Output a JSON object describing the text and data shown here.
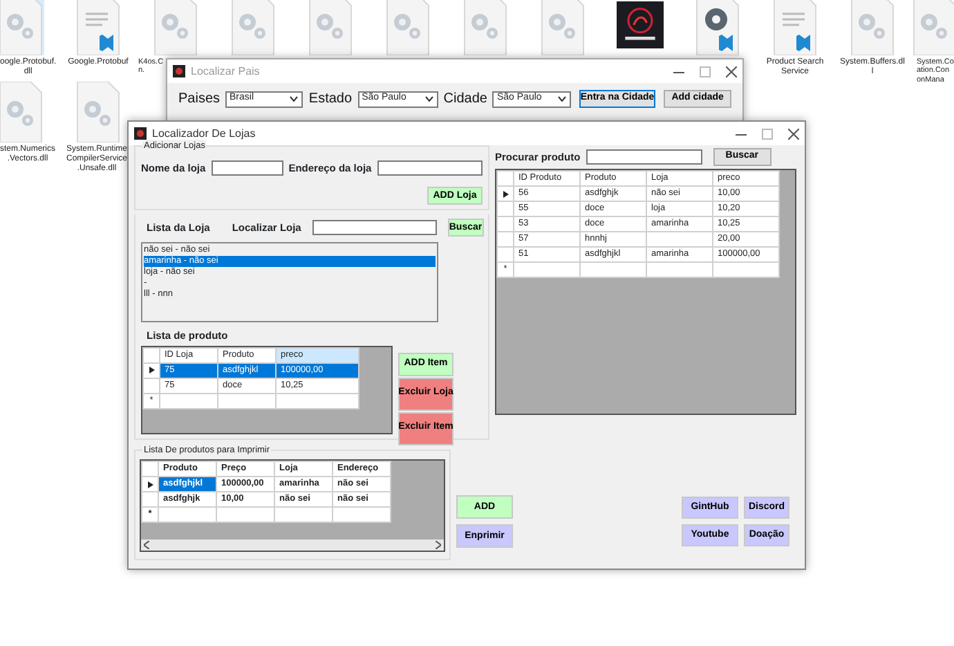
{
  "desktop": {
    "icons": [
      {
        "kind": "gear",
        "selected": true,
        "label": [
          "oogle.Protobuf.",
          "dll"
        ]
      },
      {
        "kind": "code_doc",
        "selected": false,
        "label": [
          "Google.Protobuf"
        ]
      },
      {
        "kind": "gear",
        "selected": false,
        "label": [
          "K4os.C",
          "n."
        ]
      },
      {
        "kind": "gear",
        "selected": false
      },
      {
        "kind": "gear",
        "selected": false
      },
      {
        "kind": "gear",
        "selected": false
      },
      {
        "kind": "gear",
        "selected": false
      },
      {
        "kind": "gear",
        "selected": false
      },
      {
        "kind": "logo",
        "selected": false
      },
      {
        "kind": "code_gear",
        "selected": false
      },
      {
        "kind": "code_doc",
        "selected": false,
        "label": [
          "Product Search",
          "Service"
        ]
      },
      {
        "kind": "gear",
        "selected": false,
        "label": [
          "System.Buffers.dl",
          "l"
        ]
      },
      {
        "kind": "gear",
        "selected": false,
        "label": [
          "System.Co",
          "ation.Con",
          "onMana"
        ]
      }
    ],
    "icons_row_2": [
      {
        "kind": "gear",
        "selected": false,
        "label": [
          "stem.Numerics",
          ".Vectors.dll"
        ]
      },
      {
        "kind": "gear",
        "selected": false,
        "label": [
          "System.Runtime",
          "CompilerService",
          ".Unsafe.dll"
        ]
      }
    ]
  },
  "country_window": {
    "title": "Localizar Pais",
    "fields": [
      {
        "label": "Paises",
        "value": "Brasil"
      },
      {
        "label": "Estado",
        "value": "São Paulo"
      },
      {
        "label": "Cidade",
        "value": "São Paulo"
      }
    ],
    "buttons": [
      {
        "label": "Entra na Cidade",
        "focused": true
      },
      {
        "label": "Add cidade",
        "focused": false
      }
    ]
  },
  "store_window": {
    "title": "Localizador De Lojas",
    "add_store": {
      "legend": "Adicionar Lojas",
      "fields": [
        {
          "label": "Nome da loja"
        },
        {
          "label": "Endereço da loja"
        }
      ],
      "button": "ADD Loja"
    },
    "store_list": {
      "heading": "Lista da Loja",
      "search_label": "Localizar Loja",
      "search_button": "Buscar",
      "items": [
        {
          "text": "não sei - não sei",
          "selected": false
        },
        {
          "text": "amarinha - não sei",
          "selected": true
        },
        {
          "text": "loja - não sei",
          "selected": false
        },
        {
          "text": "-",
          "selected": false
        },
        {
          "text": "lll - nnn",
          "selected": false
        }
      ]
    },
    "product_list": {
      "heading": "Lista de produto",
      "new_row_marker": "*",
      "columns": [
        {
          "label": "ID Loja",
          "selected": false
        },
        {
          "label": "Produto",
          "selected": false
        },
        {
          "label": "preco",
          "selected": true
        }
      ],
      "rows": [
        {
          "current": true,
          "cells": [
            {
              "text": "75",
              "selected": true
            },
            {
              "text": "asdfghjkl",
              "selected": true
            },
            {
              "text": "100000,00",
              "selected": true
            }
          ]
        },
        {
          "current": false,
          "cells": [
            {
              "text": "75",
              "selected": false
            },
            {
              "text": "doce",
              "selected": false
            },
            {
              "text": "10,25",
              "selected": false
            }
          ]
        }
      ],
      "buttons": [
        {
          "label": "ADD Item",
          "kind": "add"
        },
        {
          "label": "Excluir Loja",
          "kind": "delete"
        },
        {
          "label": "Excluir Item",
          "kind": "delete"
        }
      ]
    },
    "product_search": {
      "label": "Procurar produto",
      "button": "Buscar",
      "new_row_marker": "*",
      "columns": [
        {
          "label": "ID Produto",
          "selected": false
        },
        {
          "label": "Produto",
          "selected": false
        },
        {
          "label": "Loja",
          "selected": false
        },
        {
          "label": "preco",
          "selected": false
        }
      ],
      "rows": [
        {
          "current": true,
          "cells": [
            {
              "text": "56",
              "selected": false
            },
            {
              "text": "asdfghjk",
              "selected": false
            },
            {
              "text": "não sei",
              "selected": false
            },
            {
              "text": "10,00",
              "selected": false
            }
          ]
        },
        {
          "current": false,
          "cells": [
            {
              "text": "55",
              "selected": false
            },
            {
              "text": "doce",
              "selected": false
            },
            {
              "text": "loja",
              "selected": false
            },
            {
              "text": "10,20",
              "selected": false
            }
          ]
        },
        {
          "current": false,
          "cells": [
            {
              "text": "53",
              "selected": false
            },
            {
              "text": "doce",
              "selected": false
            },
            {
              "text": "amarinha",
              "selected": false
            },
            {
              "text": "10,25",
              "selected": false
            }
          ]
        },
        {
          "current": false,
          "cells": [
            {
              "text": "57",
              "selected": false
            },
            {
              "text": "hnnhj",
              "selected": false
            },
            {
              "text": null,
              "selected": false
            },
            {
              "text": "20,00",
              "selected": false
            }
          ]
        },
        {
          "current": false,
          "cells": [
            {
              "text": "51",
              "selected": false
            },
            {
              "text": "asdfghjkl",
              "selected": false
            },
            {
              "text": "amarinha",
              "selected": false
            },
            {
              "text": "100000,00",
              "selected": false
            }
          ]
        }
      ]
    },
    "print_list": {
      "legend": "Lista De produtos para Imprimir",
      "new_row_marker": "*",
      "columns": [
        {
          "label": "Produto",
          "selected": false
        },
        {
          "label": "Preço",
          "selected": false
        },
        {
          "label": "Loja",
          "selected": false
        },
        {
          "label": "Endereço",
          "selected": false
        }
      ],
      "rows": [
        {
          "current": true,
          "cells": [
            {
              "text": "asdfghjkl",
              "selected": true
            },
            {
              "text": "100000,00",
              "selected": false
            },
            {
              "text": "amarinha",
              "selected": false
            },
            {
              "text": "não sei",
              "selected": false
            }
          ]
        },
        {
          "current": false,
          "cells": [
            {
              "text": "asdfghjk",
              "selected": false
            },
            {
              "text": "10,00",
              "selected": false
            },
            {
              "text": "não sei",
              "selected": false
            },
            {
              "text": "não sei",
              "selected": false
            }
          ]
        }
      ]
    },
    "print_buttons": [
      {
        "label": "ADD",
        "kind": "add"
      },
      {
        "label": "Enprimir",
        "kind": "link"
      }
    ],
    "link_buttons": [
      {
        "label": "GintHub",
        "kind": "link"
      },
      {
        "label": "Discord",
        "kind": "link"
      },
      {
        "label": "Youtube",
        "kind": "link"
      },
      {
        "label": "Doação",
        "kind": "link"
      }
    ]
  }
}
